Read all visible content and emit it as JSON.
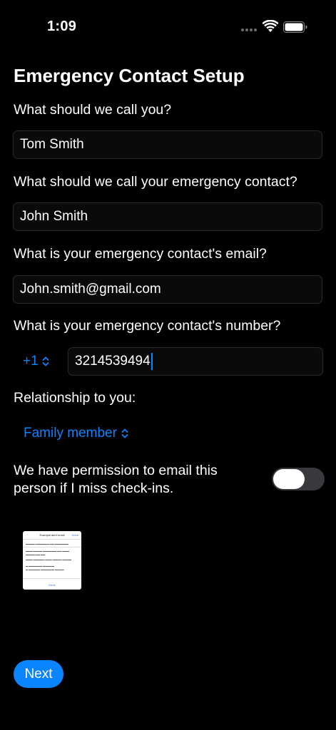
{
  "status_bar": {
    "time": "1:09",
    "icons": [
      "signal-dots-icon",
      "wifi-icon",
      "battery-icon"
    ]
  },
  "page": {
    "title": "Emergency Contact Setup"
  },
  "form": {
    "your_name": {
      "label": "What should we call you?",
      "value": "Tom Smith"
    },
    "contact_name": {
      "label": "What should we call your emergency contact?",
      "value": "John Smith"
    },
    "contact_email": {
      "label": "What is your emergency contact's email?",
      "value": "John.smith@gmail.com"
    },
    "contact_number": {
      "label": "What is your emergency contact's number?",
      "country_code": "+1",
      "value": "3214539494"
    },
    "relationship": {
      "label": "Relationship to you:",
      "selected": "Family member"
    },
    "permission": {
      "label": "We have permission to email this person if I miss check-ins.",
      "enabled": false
    }
  },
  "example_email": {
    "header": "Example alert email",
    "done_top": "Done",
    "done_bottom": "Done"
  },
  "actions": {
    "next_label": "Next"
  },
  "colors": {
    "background": "#000000",
    "accent": "#0a84ff",
    "toggle_off": "#39393d",
    "field_border": "#2a2a2a"
  }
}
